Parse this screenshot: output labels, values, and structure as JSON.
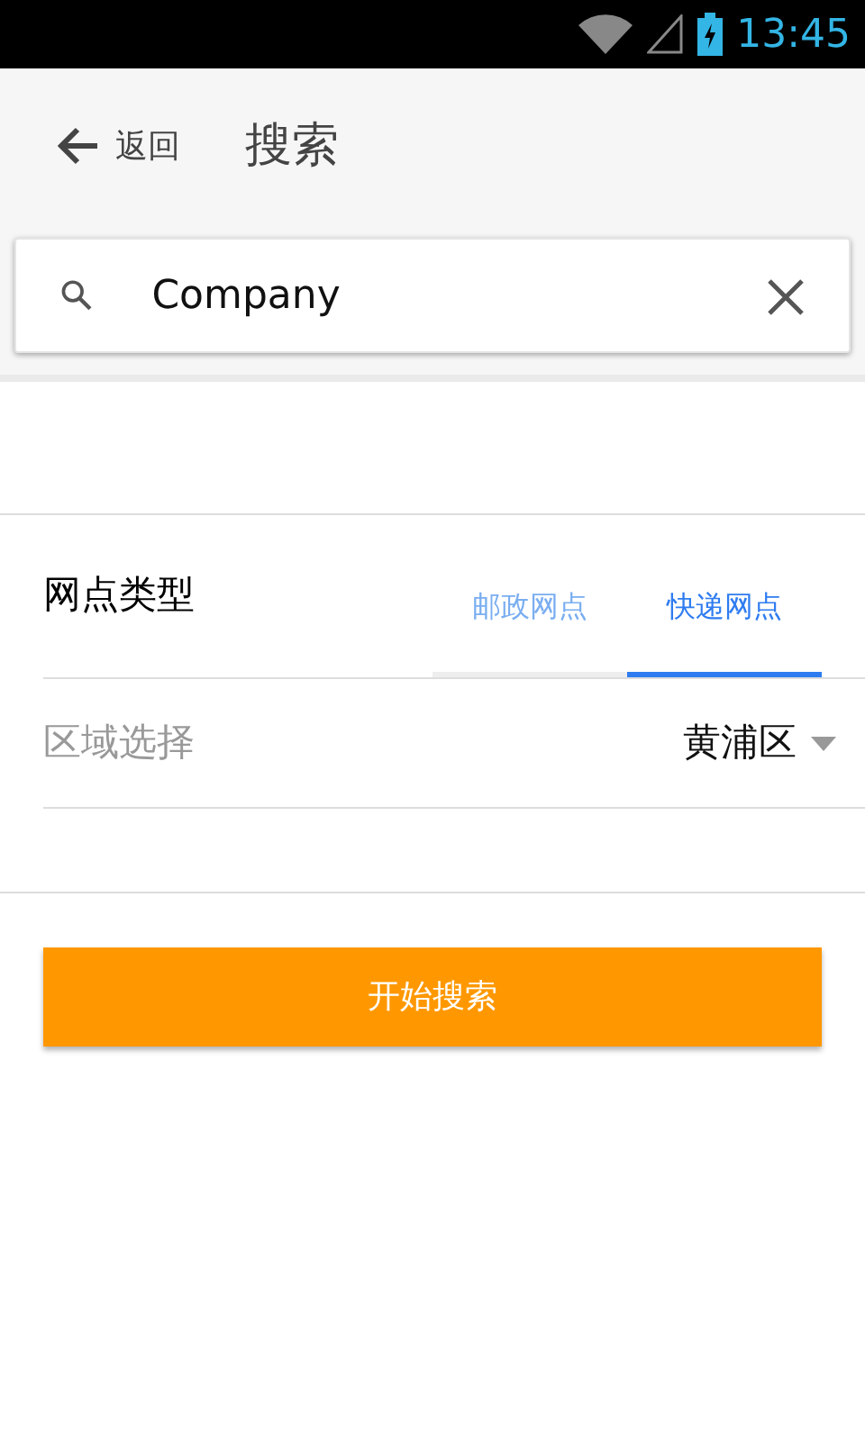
{
  "status_bar": {
    "time": "13:45"
  },
  "header": {
    "back_label": "返回",
    "title": "搜索"
  },
  "search": {
    "value": "Company"
  },
  "type_row": {
    "label": "网点类型",
    "tabs": [
      {
        "label": "邮政网点",
        "selected": false
      },
      {
        "label": "快递网点",
        "selected": true
      }
    ]
  },
  "region_row": {
    "label": "区域选择",
    "value": "黄浦区"
  },
  "submit_button": "开始搜索"
}
